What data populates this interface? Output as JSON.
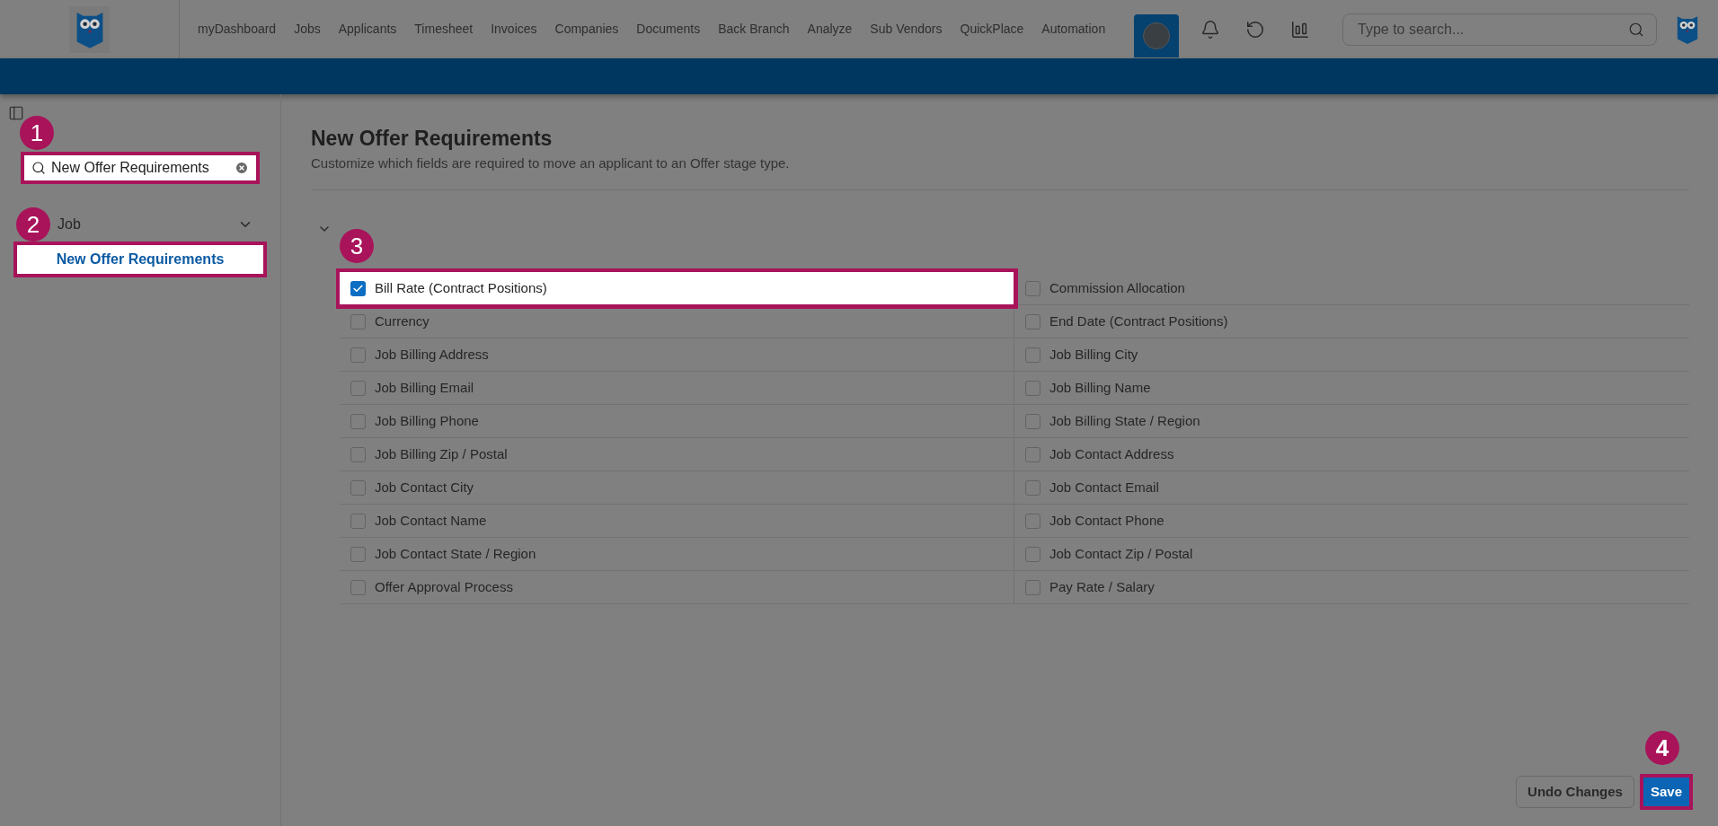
{
  "nav": {
    "items": [
      "myDashboard",
      "Jobs",
      "Applicants",
      "Timesheet",
      "Invoices",
      "Companies",
      "Documents",
      "Back Branch",
      "Analyze",
      "Sub Vendors",
      "QuickPlace",
      "Automation"
    ],
    "search": {
      "placeholder": "Type to search..."
    }
  },
  "sidebar": {
    "search": {
      "value": "New Offer Requirements",
      "highlighted": true,
      "marker": "1"
    },
    "group": {
      "label": "Job",
      "expanded": true,
      "marker": "2",
      "items": [
        {
          "label": "New Offer Requirements",
          "selected": true,
          "highlighted": true
        }
      ]
    }
  },
  "page": {
    "title": "New Offer Requirements",
    "subtitle": "Customize which fields are required to move an applicant to an Offer stage type.",
    "expanded": true,
    "fields": [
      {
        "label": "Bill Rate (Contract Positions)",
        "checked": true,
        "highlighted": true,
        "marker": "3"
      },
      {
        "label": "Commission Allocation",
        "checked": false,
        "highlighted": false
      },
      {
        "label": "Currency",
        "checked": false,
        "highlighted": false
      },
      {
        "label": "End Date (Contract Positions)",
        "checked": false,
        "highlighted": false
      },
      {
        "label": "Job Billing Address",
        "checked": false,
        "highlighted": false
      },
      {
        "label": "Job Billing City",
        "checked": false,
        "highlighted": false
      },
      {
        "label": "Job Billing Email",
        "checked": false,
        "highlighted": false
      },
      {
        "label": "Job Billing Name",
        "checked": false,
        "highlighted": false
      },
      {
        "label": "Job Billing Phone",
        "checked": false,
        "highlighted": false
      },
      {
        "label": "Job Billing State / Region",
        "checked": false,
        "highlighted": false
      },
      {
        "label": "Job Billing Zip / Postal",
        "checked": false,
        "highlighted": false
      },
      {
        "label": "Job Contact Address",
        "checked": false,
        "highlighted": false
      },
      {
        "label": "Job Contact City",
        "checked": false,
        "highlighted": false
      },
      {
        "label": "Job Contact Email",
        "checked": false,
        "highlighted": false
      },
      {
        "label": "Job Contact Name",
        "checked": false,
        "highlighted": false
      },
      {
        "label": "Job Contact Phone",
        "checked": false,
        "highlighted": false
      },
      {
        "label": "Job Contact State / Region",
        "checked": false,
        "highlighted": false
      },
      {
        "label": "Job Contact Zip / Postal",
        "checked": false,
        "highlighted": false
      },
      {
        "label": "Offer Approval Process",
        "checked": false,
        "highlighted": false
      },
      {
        "label": "Pay Rate / Salary",
        "checked": false,
        "highlighted": false
      }
    ],
    "buttons": {
      "undo": {
        "label": "Undo Changes",
        "highlighted": false
      },
      "save": {
        "label": "Save",
        "highlighted": true,
        "marker": "4"
      }
    }
  }
}
